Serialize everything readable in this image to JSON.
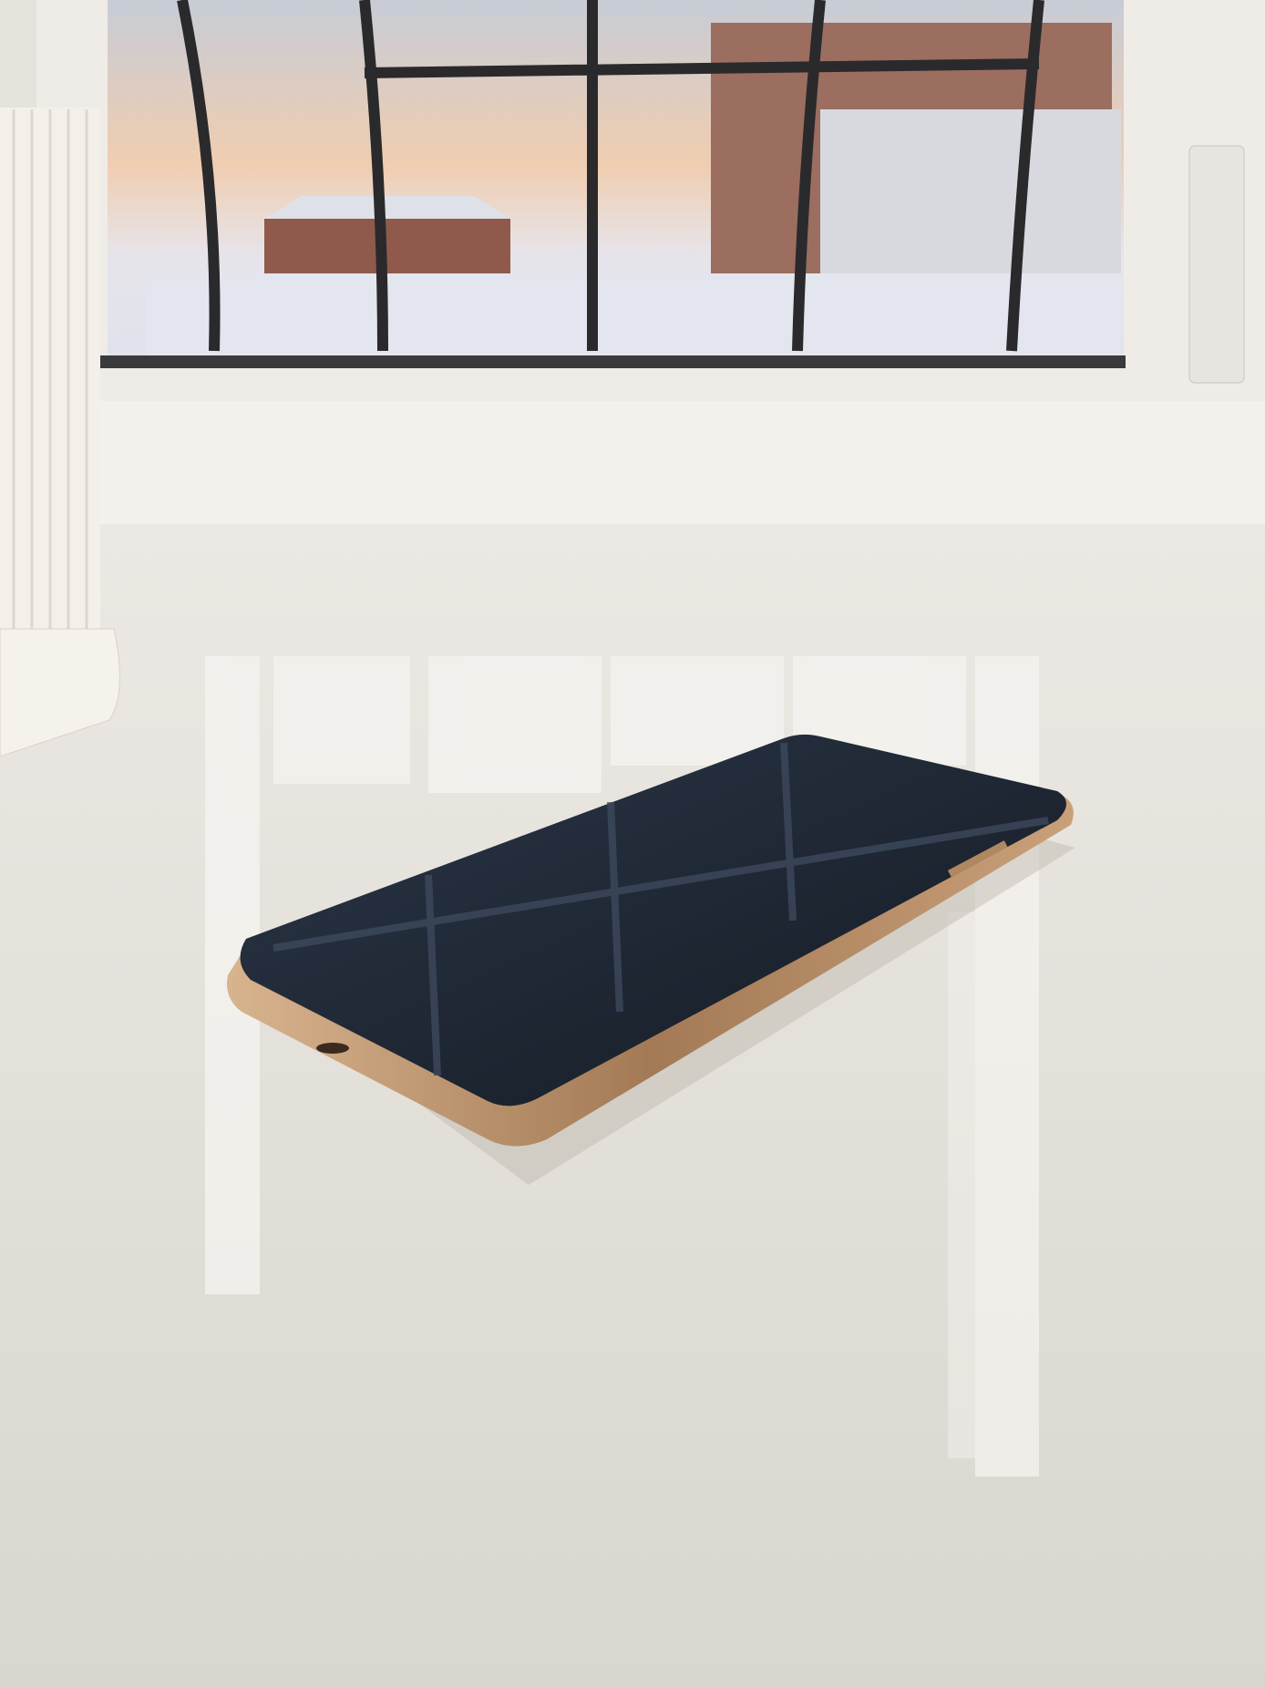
{
  "scene": {
    "sky_top": "#c9cfd8",
    "sky_horizon": "#f2c9a8",
    "counter": "#e4e0da",
    "phone_frame": "#c9a27a",
    "phone_glass": "#1c2430",
    "window_frame": "#eeebe6",
    "grille": "#2a2a2c"
  }
}
